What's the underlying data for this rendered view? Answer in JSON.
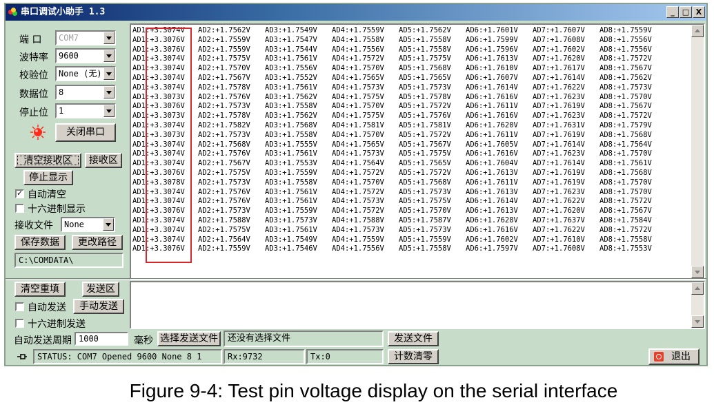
{
  "window": {
    "title": "串口调试小助手 1.3"
  },
  "window_buttons": {
    "minimize": "_",
    "maximize": "□",
    "close": "X"
  },
  "port_settings": {
    "port_label": "端 口",
    "port_value": "COM7",
    "baud_label": "波特率",
    "baud_value": "9600",
    "parity_label": "校验位",
    "parity_value": "None (无)",
    "databits_label": "数据位",
    "databits_value": "8",
    "stopbits_label": "停止位",
    "stopbits_value": "1",
    "close_port_button": "关闭串口"
  },
  "receive_controls": {
    "clear_button": "清空接收区",
    "receive_area_button": "接收区",
    "stop_display_button": "停止显示",
    "auto_clear_label": "自动清空",
    "auto_clear_checked": true,
    "hex_display_label": "十六进制显示",
    "hex_display_checked": false,
    "receive_file_label": "接收文件",
    "receive_file_value": "None",
    "save_data_button": "保存数据",
    "change_path_button": "更改路径",
    "path_value": "C:\\COMDATA\\"
  },
  "receive_rows": [
    [
      "AD1:+3.3074V",
      "AD2:+1.7562V",
      "AD3:+1.7549V",
      "AD4:+1.7559V",
      "AD5:+1.7562V",
      "AD6:+1.7601V",
      "AD7:+1.7607V",
      "AD8:+1.7559V"
    ],
    [
      "AD1:+3.3076V",
      "AD2:+1.7559V",
      "AD3:+1.7547V",
      "AD4:+1.7558V",
      "AD5:+1.7558V",
      "AD6:+1.7599V",
      "AD7:+1.7608V",
      "AD8:+1.7556V"
    ],
    [
      "AD1:+3.3076V",
      "AD2:+1.7559V",
      "AD3:+1.7544V",
      "AD4:+1.7556V",
      "AD5:+1.7558V",
      "AD6:+1.7596V",
      "AD7:+1.7602V",
      "AD8:+1.7556V"
    ],
    [
      "AD1:+3.3074V",
      "AD2:+1.7575V",
      "AD3:+1.7561V",
      "AD4:+1.7572V",
      "AD5:+1.7575V",
      "AD6:+1.7613V",
      "AD7:+1.7620V",
      "AD8:+1.7572V"
    ],
    [
      "AD1:+3.3074V",
      "AD2:+1.7570V",
      "AD3:+1.7556V",
      "AD4:+1.7570V",
      "AD5:+1.7568V",
      "AD6:+1.7610V",
      "AD7:+1.7617V",
      "AD8:+1.7567V"
    ],
    [
      "AD1:+3.3074V",
      "AD2:+1.7567V",
      "AD3:+1.7552V",
      "AD4:+1.7565V",
      "AD5:+1.7565V",
      "AD6:+1.7607V",
      "AD7:+1.7614V",
      "AD8:+1.7562V"
    ],
    [
      "AD1:+3.3074V",
      "AD2:+1.7578V",
      "AD3:+1.7561V",
      "AD4:+1.7573V",
      "AD5:+1.7573V",
      "AD6:+1.7614V",
      "AD7:+1.7622V",
      "AD8:+1.7573V"
    ],
    [
      "AD1:+3.3073V",
      "AD2:+1.7576V",
      "AD3:+1.7562V",
      "AD4:+1.7575V",
      "AD5:+1.7578V",
      "AD6:+1.7616V",
      "AD7:+1.7623V",
      "AD8:+1.7570V"
    ],
    [
      "AD1:+3.3076V",
      "AD2:+1.7573V",
      "AD3:+1.7558V",
      "AD4:+1.7570V",
      "AD5:+1.7572V",
      "AD6:+1.7611V",
      "AD7:+1.7619V",
      "AD8:+1.7567V"
    ],
    [
      "AD1:+3.3073V",
      "AD2:+1.7578V",
      "AD3:+1.7562V",
      "AD4:+1.7575V",
      "AD5:+1.7576V",
      "AD6:+1.7616V",
      "AD7:+1.7623V",
      "AD8:+1.7572V"
    ],
    [
      "AD1:+3.3074V",
      "AD2:+1.7582V",
      "AD3:+1.7568V",
      "AD4:+1.7581V",
      "AD5:+1.7581V",
      "AD6:+1.7620V",
      "AD7:+1.7631V",
      "AD8:+1.7579V"
    ],
    [
      "AD1:+3.3073V",
      "AD2:+1.7573V",
      "AD3:+1.7558V",
      "AD4:+1.7570V",
      "AD5:+1.7572V",
      "AD6:+1.7611V",
      "AD7:+1.7619V",
      "AD8:+1.7568V"
    ],
    [
      "AD1:+3.3074V",
      "AD2:+1.7568V",
      "AD3:+1.7555V",
      "AD4:+1.7565V",
      "AD5:+1.7567V",
      "AD6:+1.7605V",
      "AD7:+1.7614V",
      "AD8:+1.7564V"
    ],
    [
      "AD1:+3.3074V",
      "AD2:+1.7576V",
      "AD3:+1.7561V",
      "AD4:+1.7573V",
      "AD5:+1.7575V",
      "AD6:+1.7616V",
      "AD7:+1.7623V",
      "AD8:+1.7570V"
    ],
    [
      "AD1:+3.3074V",
      "AD2:+1.7567V",
      "AD3:+1.7553V",
      "AD4:+1.7564V",
      "AD5:+1.7565V",
      "AD6:+1.7604V",
      "AD7:+1.7614V",
      "AD8:+1.7561V"
    ],
    [
      "AD1:+3.3076V",
      "AD2:+1.7575V",
      "AD3:+1.7559V",
      "AD4:+1.7572V",
      "AD5:+1.7572V",
      "AD6:+1.7613V",
      "AD7:+1.7619V",
      "AD8:+1.7568V"
    ],
    [
      "AD1:+3.3078V",
      "AD2:+1.7573V",
      "AD3:+1.7558V",
      "AD4:+1.7570V",
      "AD5:+1.7568V",
      "AD6:+1.7611V",
      "AD7:+1.7619V",
      "AD8:+1.7570V"
    ],
    [
      "AD1:+3.3074V",
      "AD2:+1.7576V",
      "AD3:+1.7561V",
      "AD4:+1.7572V",
      "AD5:+1.7573V",
      "AD6:+1.7613V",
      "AD7:+1.7623V",
      "AD8:+1.7570V"
    ],
    [
      "AD1:+3.3074V",
      "AD2:+1.7576V",
      "AD3:+1.7561V",
      "AD4:+1.7573V",
      "AD5:+1.7575V",
      "AD6:+1.7614V",
      "AD7:+1.7622V",
      "AD8:+1.7572V"
    ],
    [
      "AD1:+3.3076V",
      "AD2:+1.7573V",
      "AD3:+1.7559V",
      "AD4:+1.7572V",
      "AD5:+1.7570V",
      "AD6:+1.7613V",
      "AD7:+1.7620V",
      "AD8:+1.7567V"
    ],
    [
      "AD1:+3.3074V",
      "AD2:+1.7588V",
      "AD3:+1.7573V",
      "AD4:+1.7588V",
      "AD5:+1.7587V",
      "AD6:+1.7628V",
      "AD7:+1.7637V",
      "AD8:+1.7584V"
    ],
    [
      "AD1:+3.3074V",
      "AD2:+1.7575V",
      "AD3:+1.7561V",
      "AD4:+1.7573V",
      "AD5:+1.7573V",
      "AD6:+1.7616V",
      "AD7:+1.7622V",
      "AD8:+1.7572V"
    ],
    [
      "AD1:+3.3074V",
      "AD2:+1.7564V",
      "AD3:+1.7549V",
      "AD4:+1.7559V",
      "AD5:+1.7559V",
      "AD6:+1.7602V",
      "AD7:+1.7610V",
      "AD8:+1.7558V"
    ],
    [
      "AD1:+3.3076V",
      "AD2:+1.7559V",
      "AD3:+1.7546V",
      "AD4:+1.7556V",
      "AD5:+1.7558V",
      "AD6:+1.7597V",
      "AD7:+1.7608V",
      "AD8:+1.7553V"
    ]
  ],
  "send_controls": {
    "clear_resend_button": "清空重填",
    "send_area_button": "发送区",
    "auto_send_label": "自动发送",
    "auto_send_checked": false,
    "manual_send_button": "手动发送",
    "hex_send_label": "十六进制发送",
    "hex_send_checked": false,
    "period_label": "自动发送周期",
    "period_value": "1000",
    "period_unit": "毫秒",
    "select_file_button": "选择发送文件",
    "file_status": "还没有选择文件",
    "send_file_button": "发送文件"
  },
  "status_bar": {
    "status_text": "STATUS: COM7 Opened 9600 None  8 1",
    "rx_text": "Rx:9732",
    "tx_text": "Tx:0",
    "reset_count_button": "计数清零",
    "exit_button": "退出"
  },
  "colors": {
    "highlight": "#d8262c",
    "window_bg": "#c7dcc9",
    "led": "#ff2a1a"
  },
  "caption": "Figure 9-4: Test pin voltage display on the serial interface"
}
